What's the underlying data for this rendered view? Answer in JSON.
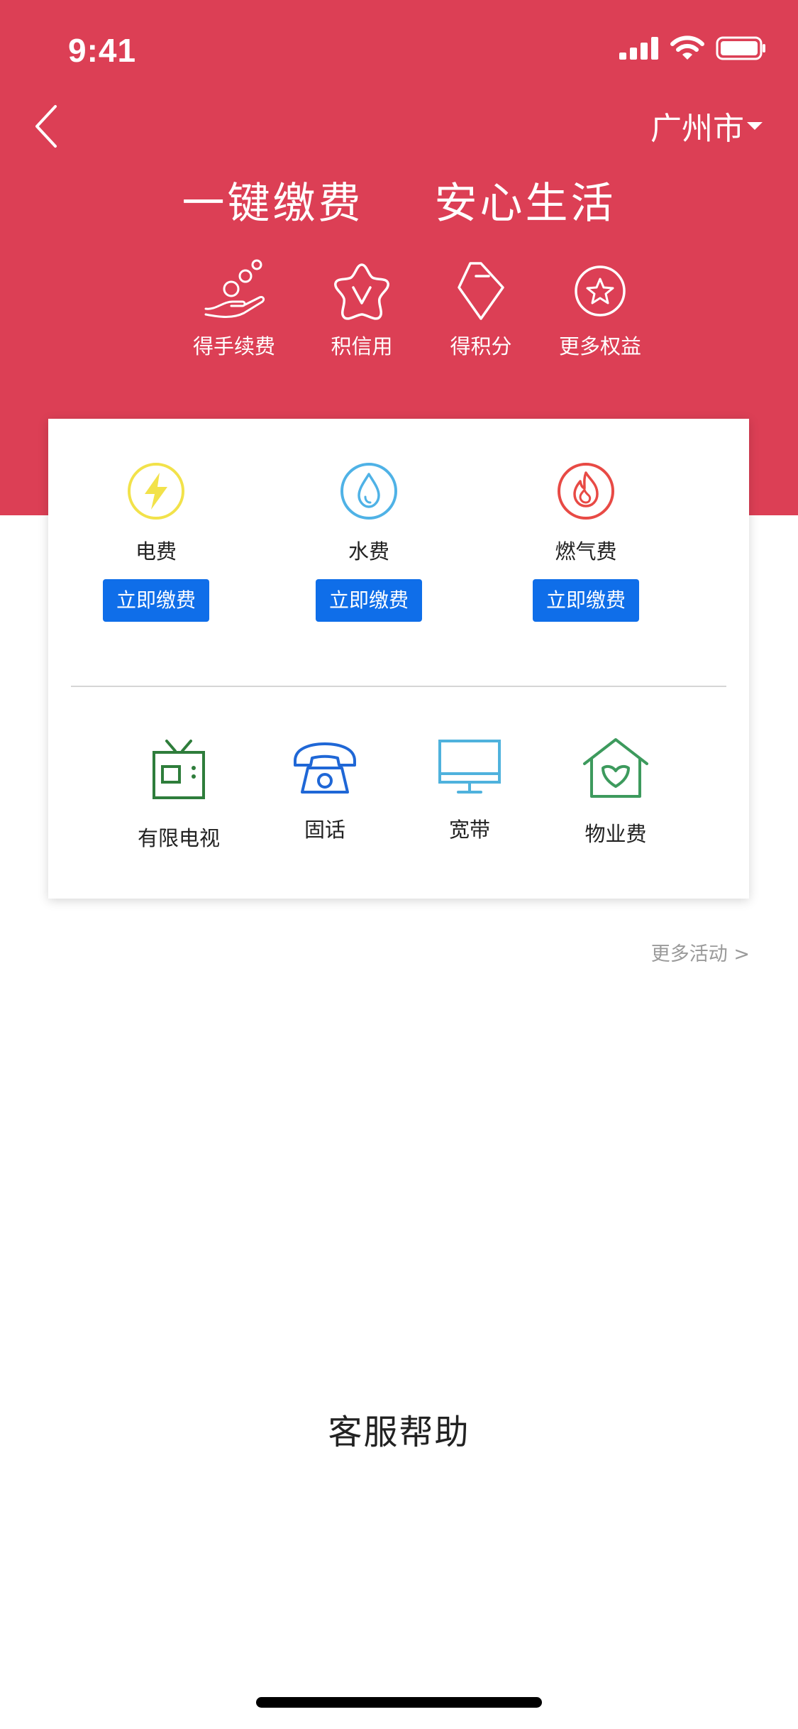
{
  "status_bar": {
    "time": "9:41"
  },
  "header": {
    "city": "广州市",
    "slogan": [
      "一键缴费",
      "安心生活"
    ],
    "benefits": [
      {
        "label": "得手续费",
        "icon": "hand-coins-icon"
      },
      {
        "label": "积信用",
        "icon": "star-v-icon"
      },
      {
        "label": "得积分",
        "icon": "diamond-icon"
      },
      {
        "label": "更多权益",
        "icon": "star-circle-icon"
      }
    ]
  },
  "utilities": [
    {
      "label": "电费",
      "button": "立即缴费",
      "icon": "lightning-icon",
      "color": "#f2e24a"
    },
    {
      "label": "水费",
      "button": "立即缴费",
      "icon": "water-drop-icon",
      "color": "#4fb2e6"
    },
    {
      "label": "燃气费",
      "button": "立即缴费",
      "icon": "flame-icon",
      "color": "#e84a45"
    }
  ],
  "services": [
    {
      "label": "有限电视",
      "icon": "tv-icon",
      "color": "#2e7d3b"
    },
    {
      "label": "固话",
      "icon": "telephone-icon",
      "color": "#1f67d6"
    },
    {
      "label": "宽带",
      "icon": "monitor-icon",
      "color": "#4fb2dd"
    },
    {
      "label": "物业费",
      "icon": "house-icon",
      "color": "#3d9a5d"
    }
  ],
  "more_activities": "更多活动 >",
  "help_title": "客服帮助",
  "colors": {
    "header_red": "#dc3f55",
    "button_blue": "#0f6ee9"
  }
}
